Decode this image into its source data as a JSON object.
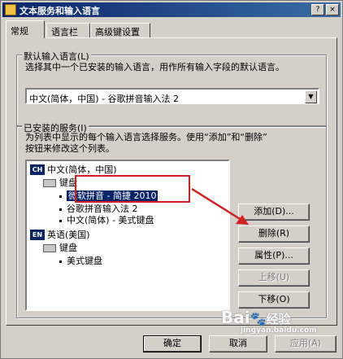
{
  "window": {
    "title": "文本服务和输入语言",
    "help_button": "?",
    "close_button": "×"
  },
  "tabs": [
    {
      "label": "常规",
      "active": true
    },
    {
      "label": "语言栏",
      "active": false
    },
    {
      "label": "高级键设置",
      "active": false
    }
  ],
  "default_language": {
    "group_label": "默认输入语言(L)",
    "description": "选择其中一个已安装的输入语言，用作所有输入字段的默认语言。",
    "selected_value": "中文(简体，中国) - 谷歌拼音输入法 2"
  },
  "installed_services": {
    "group_label": "已安装的服务(I)",
    "description_line1": "为列表中显示的每个输入语言选择服务。使用“添加”和“删除”",
    "description_line2": "按钮来修改这个列表。",
    "tree": {
      "lang1": {
        "badge": "CH",
        "label": "中文(简体，中国)"
      },
      "lang1_keyboard_group": "键盘",
      "lang1_items": [
        "微软拼音 - 简捷 2010",
        "谷歌拼音输入法 2",
        "中文(简体) - 美式键盘"
      ],
      "lang2": {
        "badge": "EN",
        "label": "英语(美国)"
      },
      "lang2_keyboard_group": "键盘",
      "lang2_items": [
        "美式键盘"
      ]
    },
    "buttons": {
      "add": "添加(D)...",
      "remove": "删除(R)",
      "properties": "属性(P)...",
      "move_up": "上移(U)",
      "move_down": "下移(O)"
    }
  },
  "footer": {
    "ok": "确定",
    "cancel": "取消",
    "apply": "应用(A)"
  },
  "watermark": {
    "brand": "Bai",
    "suffix": "经验",
    "url": "jingyan.baidu.com"
  },
  "colors": {
    "annotation": "#d21f1f",
    "title_bar": "#0a246a",
    "selection": "#0a246a"
  }
}
